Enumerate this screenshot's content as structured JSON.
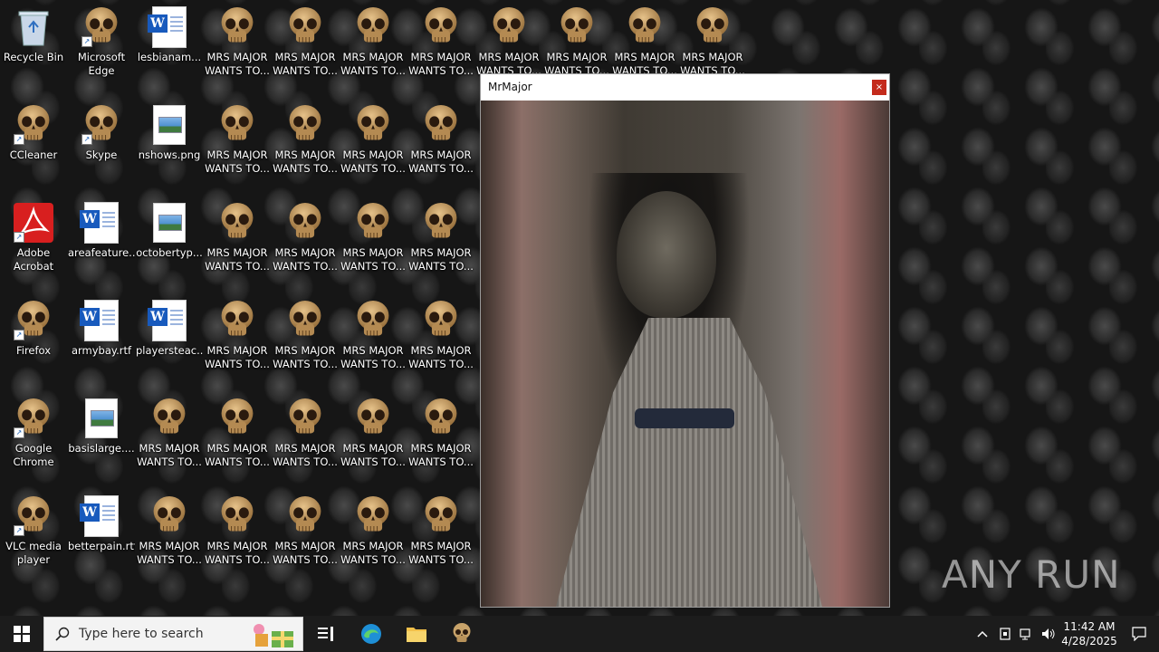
{
  "desktop": {
    "icons": [
      {
        "label": "Recycle Bin",
        "type": "recycle",
        "col": 0,
        "row": 0
      },
      {
        "label": "Microsoft Edge",
        "type": "skull",
        "shortcut": true,
        "col": 1,
        "row": 0
      },
      {
        "label": "lesbianam...",
        "type": "word",
        "col": 2,
        "row": 0
      },
      {
        "label": "MRS MAJOR WANTS TO...",
        "type": "skull",
        "col": 3,
        "row": 0
      },
      {
        "label": "MRS MAJOR WANTS TO...",
        "type": "skull",
        "col": 4,
        "row": 0
      },
      {
        "label": "MRS MAJOR WANTS TO...",
        "type": "skull",
        "col": 5,
        "row": 0
      },
      {
        "label": "MRS MAJOR WANTS TO...",
        "type": "skull",
        "col": 6,
        "row": 0
      },
      {
        "label": "MRS MAJOR WANTS TO...",
        "type": "skull",
        "col": 7,
        "row": 0
      },
      {
        "label": "MRS MAJOR WANTS TO...",
        "type": "skull",
        "col": 8,
        "row": 0
      },
      {
        "label": "MRS MAJOR WANTS TO...",
        "type": "skull",
        "col": 9,
        "row": 0
      },
      {
        "label": "MRS MAJOR WANTS TO...",
        "type": "skull",
        "col": 10,
        "row": 0
      },
      {
        "label": "CCleaner",
        "type": "skull",
        "shortcut": true,
        "col": 0,
        "row": 1
      },
      {
        "label": "Skype",
        "type": "skull",
        "shortcut": true,
        "col": 1,
        "row": 1
      },
      {
        "label": "nshows.png",
        "type": "png",
        "col": 2,
        "row": 1
      },
      {
        "label": "MRS MAJOR WANTS TO...",
        "type": "skull",
        "col": 3,
        "row": 1
      },
      {
        "label": "MRS MAJOR WANTS TO...",
        "type": "skull",
        "col": 4,
        "row": 1
      },
      {
        "label": "MRS MAJOR WANTS TO...",
        "type": "skull",
        "col": 5,
        "row": 1
      },
      {
        "label": "MRS MAJOR WANTS TO...",
        "type": "skull",
        "col": 6,
        "row": 1
      },
      {
        "label": "Adobe Acrobat",
        "type": "acrobat",
        "shortcut": true,
        "col": 0,
        "row": 2
      },
      {
        "label": "areafeature...",
        "type": "word",
        "col": 1,
        "row": 2
      },
      {
        "label": "octobertyp...",
        "type": "png",
        "col": 2,
        "row": 2
      },
      {
        "label": "MRS MAJOR WANTS TO...",
        "type": "skull",
        "col": 3,
        "row": 2
      },
      {
        "label": "MRS MAJOR WANTS TO...",
        "type": "skull",
        "col": 4,
        "row": 2
      },
      {
        "label": "MRS MAJOR WANTS TO...",
        "type": "skull",
        "col": 5,
        "row": 2
      },
      {
        "label": "MRS MAJOR WANTS TO...",
        "type": "skull",
        "col": 6,
        "row": 2
      },
      {
        "label": "Firefox",
        "type": "skull",
        "shortcut": true,
        "col": 0,
        "row": 3
      },
      {
        "label": "armybay.rtf",
        "type": "word",
        "col": 1,
        "row": 3
      },
      {
        "label": "playersteac...",
        "type": "word",
        "col": 2,
        "row": 3
      },
      {
        "label": "MRS MAJOR WANTS TO...",
        "type": "skull",
        "col": 3,
        "row": 3
      },
      {
        "label": "MRS MAJOR WANTS TO...",
        "type": "skull",
        "col": 4,
        "row": 3
      },
      {
        "label": "MRS MAJOR WANTS TO...",
        "type": "skull",
        "col": 5,
        "row": 3
      },
      {
        "label": "MRS MAJOR WANTS TO...",
        "type": "skull",
        "col": 6,
        "row": 3
      },
      {
        "label": "Google Chrome",
        "type": "skull",
        "shortcut": true,
        "col": 0,
        "row": 4
      },
      {
        "label": "basislarge....",
        "type": "png",
        "col": 1,
        "row": 4
      },
      {
        "label": "MRS MAJOR WANTS TO...",
        "type": "skull",
        "col": 2,
        "row": 4
      },
      {
        "label": "MRS MAJOR WANTS TO...",
        "type": "skull",
        "col": 3,
        "row": 4
      },
      {
        "label": "MRS MAJOR WANTS TO...",
        "type": "skull",
        "col": 4,
        "row": 4
      },
      {
        "label": "MRS MAJOR WANTS TO...",
        "type": "skull",
        "col": 5,
        "row": 4
      },
      {
        "label": "MRS MAJOR WANTS TO...",
        "type": "skull",
        "col": 6,
        "row": 4
      },
      {
        "label": "VLC media player",
        "type": "skull",
        "shortcut": true,
        "col": 0,
        "row": 5
      },
      {
        "label": "betterpain.rtf",
        "type": "word",
        "col": 1,
        "row": 5
      },
      {
        "label": "MRS MAJOR WANTS TO...",
        "type": "skull",
        "col": 2,
        "row": 5
      },
      {
        "label": "MRS MAJOR WANTS TO...",
        "type": "skull",
        "col": 3,
        "row": 5
      },
      {
        "label": "MRS MAJOR WANTS TO...",
        "type": "skull",
        "col": 4,
        "row": 5
      },
      {
        "label": "MRS MAJOR WANTS TO...",
        "type": "skull",
        "col": 5,
        "row": 5
      },
      {
        "label": "MRS MAJOR WANTS TO...",
        "type": "skull",
        "col": 6,
        "row": 5
      }
    ]
  },
  "window": {
    "title": "MrMajor",
    "close_label": "×"
  },
  "taskbar": {
    "search_placeholder": "Type here to search",
    "time": "11:42 AM",
    "date": "4/28/2025"
  },
  "watermark": "ANY RUN"
}
